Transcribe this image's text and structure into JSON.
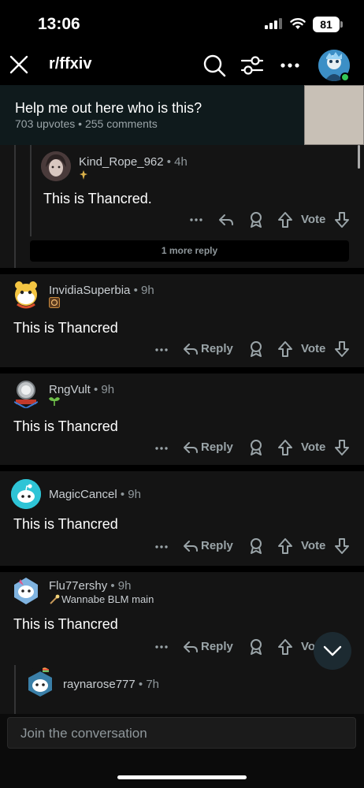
{
  "status_bar": {
    "time": "13:06",
    "battery": "81"
  },
  "nav": {
    "subreddit": "r/ffxiv",
    "icons": [
      "close-icon",
      "search-icon",
      "sliders-icon",
      "more-icon",
      "avatar"
    ]
  },
  "post": {
    "title": "Help me out here who is this?",
    "meta": "703 upvotes • 255 comments"
  },
  "comments": [
    {
      "user": "Kind_Rope_962",
      "time": "• 4h",
      "flair": "",
      "text": "This is Thancred.",
      "reply": "",
      "vote": "Vote"
    },
    {
      "more_replies": "1 more reply"
    },
    {
      "user": "InvidiaSuperbia",
      "time": "• 9h",
      "flair": "",
      "text": "This is Thancred",
      "reply": "Reply",
      "vote": "Vote"
    },
    {
      "user": "RngVult",
      "time": "• 9h",
      "flair": "",
      "text": "This is Thancred",
      "reply": "Reply",
      "vote": "Vote"
    },
    {
      "user": "MagicCancel",
      "time": "• 9h",
      "flair": "",
      "text": "This is Thancred",
      "reply": "Reply",
      "vote": "Vote"
    },
    {
      "user": "Flu77ershy",
      "time": "• 9h",
      "flair": "Wannabe BLM main",
      "text": "This is Thancred",
      "reply": "Reply",
      "vote": "Vo"
    },
    {
      "user": "raynarose777",
      "time": "• 7h",
      "flair": "",
      "text": "",
      "reply": "",
      "vote": ""
    }
  ],
  "composer": {
    "placeholder": "Join the conversation"
  },
  "colors": {
    "background": "#000000",
    "card": "#141414",
    "online": "#34c759"
  }
}
